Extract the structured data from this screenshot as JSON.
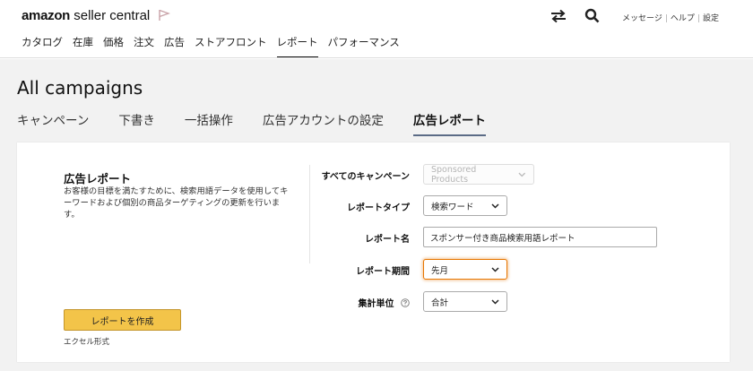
{
  "header": {
    "logo_brand": "amazon",
    "logo_product": " seller central",
    "utility_links": [
      "メッセージ",
      "ヘルプ",
      "設定"
    ],
    "icons": [
      "flag-icon",
      "swap-arrows-icon",
      "search-icon"
    ]
  },
  "nav": {
    "items": [
      "カタログ",
      "在庫",
      "価格",
      "注文",
      "広告",
      "ストアフロント",
      "レポート",
      "パフォーマンス"
    ],
    "active_index": 6
  },
  "page": {
    "title": "All campaigns",
    "tabs": [
      "キャンペーン",
      "下書き",
      "一括操作",
      "広告アカウントの設定",
      "広告レポート"
    ],
    "active_tab_index": 4
  },
  "report_card": {
    "title": "広告レポート",
    "description": "お客様の目標を満たすために、検索用語データを使用してキーワードおよび個別の商品ターゲティングの更新を行います。",
    "create_button": "レポートを作成",
    "format_note": "エクセル形式",
    "fields": {
      "campaigns": {
        "label": "すべてのキャンペーン",
        "value": "Sponsored Products"
      },
      "report_type": {
        "label": "レポートタイプ",
        "value": "検索ワード"
      },
      "report_name": {
        "label": "レポート名",
        "value": "スポンサー付き商品検索用語レポート"
      },
      "report_period": {
        "label": "レポート期間",
        "value": "先月"
      },
      "aggregation": {
        "label": "集計単位",
        "value": "合計"
      }
    }
  },
  "colors": {
    "button_yellow": "#f3c449",
    "focus_orange": "#e77600",
    "active_tab_underline": "#5b6b86",
    "content_bg": "#f2f2f2"
  }
}
